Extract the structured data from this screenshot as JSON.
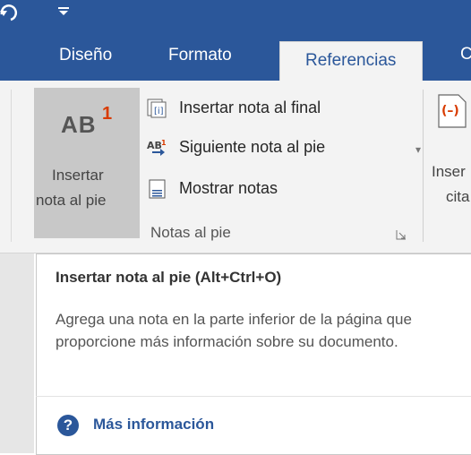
{
  "ribbon": {
    "tabs": [
      {
        "label": "Diseño"
      },
      {
        "label": "Formato"
      },
      {
        "label": "Referencias",
        "active": true
      },
      {
        "label": "C"
      }
    ],
    "footnotes_group": {
      "insert_footnote": {
        "line1": "Insertar",
        "line2": "nota al pie",
        "icon": "AB",
        "superscript": "1"
      },
      "insert_endnote": {
        "label": "Insertar nota al final",
        "icon": "endnote-icon"
      },
      "next_footnote": {
        "label": "Siguiente nota al pie",
        "icon": "next-footnote-icon"
      },
      "show_notes": {
        "label": "Mostrar notas",
        "icon": "show-notes-icon"
      },
      "label": "Notas al pie"
    },
    "citations_group": {
      "line1": "Inser",
      "line2": "cita"
    }
  },
  "tooltip": {
    "title": "Insertar nota al pie (Alt+Ctrl+O)",
    "body": "Agrega una nota en la parte inferior de la página que proporcione más información sobre su documento.",
    "link": "Más información",
    "help_icon": "?"
  },
  "colors": {
    "accent": "#2b579a",
    "footnote_number": "#d83b01"
  }
}
